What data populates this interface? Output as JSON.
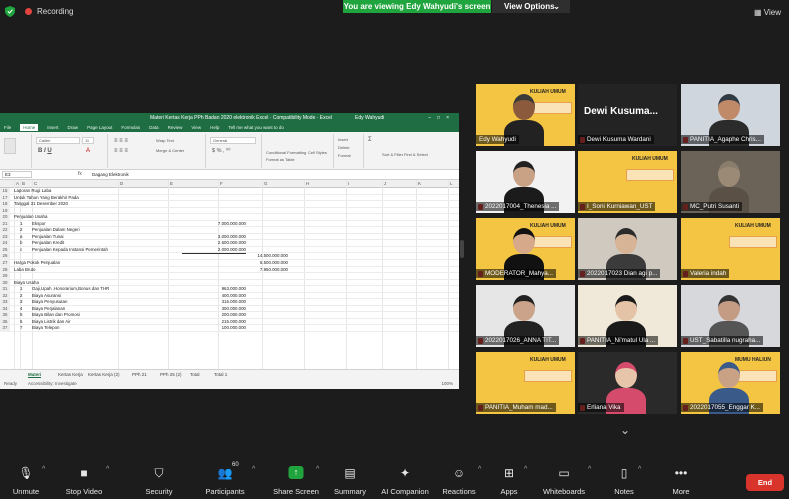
{
  "topbar": {
    "recording": "Recording",
    "viewing": "You are viewing Edy Wahyudi's screen",
    "view_options": "View Options",
    "view_options_caret": "⌄",
    "view": "View"
  },
  "excel": {
    "title": "Materi Kertas Kerja PPh Badan 2020 elektronik Excel · Compatibility Mode · Excel",
    "user": "Edy Wahyudi",
    "tabs": [
      "File",
      "Home",
      "Insert",
      "Draw",
      "Page Layout",
      "Formulas",
      "Data",
      "Review",
      "View",
      "Help",
      "Tell me what you want to do"
    ],
    "active_tab": "Home",
    "font_name": "Calibri",
    "font_size": "11",
    "wrap_text": "Wrap Text",
    "merge_center": "Merge & Center",
    "number_format": "General",
    "conditional_formatting": "Conditional Formatting",
    "format_as_table": "Format as Table",
    "cell_styles": "Cell Styles",
    "insert": "Insert",
    "delete": "Delete",
    "format": "Format",
    "sort_filter": "Sort & Filter",
    "find_select": "Find & Select",
    "name_box": "E3",
    "fx": "fx",
    "formula": "Dagang Elektronik",
    "columns": [
      "A",
      "B",
      "C",
      "D",
      "E",
      "F",
      "G",
      "H",
      "I",
      "J",
      "K",
      "L"
    ],
    "rows": [
      {
        "n": "15",
        "b": "Laporan Rugi Laba",
        "v": "",
        "w": ""
      },
      {
        "n": "17",
        "b": "Untuk Tahun Yang Berakhir Pada",
        "v": "",
        "w": ""
      },
      {
        "n": "18",
        "b": "Tanggal 31 Desember 2020",
        "v": "",
        "w": ""
      },
      {
        "n": "19",
        "b": "",
        "v": "",
        "w": ""
      },
      {
        "n": "20",
        "b": "Penjualan Usaha",
        "v": "",
        "w": ""
      },
      {
        "n": "21",
        "c": "1",
        "d": "Ekspor",
        "v": "7.000.000.000",
        "w": ""
      },
      {
        "n": "22",
        "c": "2",
        "d": "Penjualan Dalam Negeri",
        "v": "",
        "w": ""
      },
      {
        "n": "23",
        "c": "a",
        "d": "Penjualan Tunai",
        "v": "3.000.000.000",
        "w": ""
      },
      {
        "n": "24",
        "c": "b",
        "d": "Penjualan Kredit",
        "v": "2.500.000.000",
        "w": ""
      },
      {
        "n": "25",
        "c": "c",
        "d": "Penjualan Kepada Instansi Pemerintah",
        "v": "2.000.000.000",
        "w": "",
        "hl": true
      },
      {
        "n": "26",
        "b": "",
        "v": "",
        "w": "14.500.000.000"
      },
      {
        "n": "27",
        "b": "Harga Pokok Penjualan",
        "v": "",
        "w": "6.500.000.000"
      },
      {
        "n": "28",
        "b": "Laba Bruto",
        "v": "",
        "w": "7.950.000.000"
      },
      {
        "n": "29",
        "b": "",
        "v": "",
        "w": ""
      },
      {
        "n": "30",
        "b": "Biaya Usaha",
        "v": "",
        "w": ""
      },
      {
        "n": "31",
        "c": "1",
        "d": "Gaji,Upah ,Honorarium,Bonus dan THR",
        "v": "963.000.000",
        "w": ""
      },
      {
        "n": "32",
        "c": "2",
        "d": "Biaya Asuransi",
        "v": "400.000.000",
        "w": ""
      },
      {
        "n": "33",
        "c": "3",
        "d": "Biaya Penyusutan",
        "v": "315.000.000",
        "w": ""
      },
      {
        "n": "34",
        "c": "4",
        "d": "Biaya Perjalanan",
        "v": "300.000.000",
        "w": ""
      },
      {
        "n": "35",
        "c": "5",
        "d": "Biaya Bilan dan Promosi",
        "v": "200.000.000",
        "w": ""
      },
      {
        "n": "36",
        "c": "6",
        "d": "Biaya Listrik dan Air",
        "v": "215.000.000",
        "w": ""
      },
      {
        "n": "37",
        "c": "7",
        "d": "Biaya Telepon",
        "v": "100.000.000",
        "w": ""
      }
    ],
    "sheets": [
      "Materi",
      "Kertas Kerja",
      "Kertas Kerja (2)",
      "PPh 21",
      "PPh 25 (2)",
      "Total",
      "Total 1"
    ],
    "active_sheet": "Materi",
    "status_ready": "Ready",
    "status_access": "Accessibility: Investigate",
    "zoom": "100%"
  },
  "participants": [
    {
      "id": "edy",
      "name": "Edy Wahyudi",
      "active": true
    },
    {
      "id": "dewi",
      "name": "Dewi Kusuma Wardani",
      "big_name": "Dewi  Kusuma..."
    },
    {
      "id": "agape",
      "name": "PANITIA_Agaphe Chris..."
    },
    {
      "id": "thenesia",
      "name": "2022017004_Thenesia ..."
    },
    {
      "id": "soni",
      "name": "I_Soni Kurniawan_UST"
    },
    {
      "id": "mc",
      "name": "MC_Putri Susanti"
    },
    {
      "id": "moderator",
      "name": "MODERATOR_Mahya..."
    },
    {
      "id": "dian",
      "name": "2022017023 Dian agi p..."
    },
    {
      "id": "valeria",
      "name": "Valeria indah"
    },
    {
      "id": "anna",
      "name": "2022017026_ANNA TIT..."
    },
    {
      "id": "nimatul",
      "name": "PANITIA_Ni'matul Ula ..."
    },
    {
      "id": "sabatilla",
      "name": "UST_Sabatilla nugraha..."
    },
    {
      "id": "muhammad",
      "name": "PANITIA_Muham mad..."
    },
    {
      "id": "erliana",
      "name": "Erliana Vika"
    },
    {
      "id": "enggar",
      "name": "2022017055_Enggar K..."
    }
  ],
  "poster": {
    "line1": "KULIAH UMUM",
    "line2": "PRAKTIK PERPAJAKAN 2",
    "line3": "MUMU HALIUN"
  },
  "toolbar": {
    "unmute": "Unmute",
    "stop_video": "Stop Video",
    "security": "Security",
    "participants": "Participants",
    "participants_count": "60",
    "share_screen": "Share Screen",
    "summary": "Summary",
    "ai_companion": "AI Companion",
    "reactions": "Reactions",
    "apps": "Apps",
    "whiteboards": "Whiteboards",
    "notes": "Notes",
    "more": "More",
    "end": "End"
  },
  "colors": {
    "accent_green": "#20a53e",
    "end_red": "#d9342b",
    "excel_green": "#1f6e43",
    "poster_yellow": "#f4c542"
  }
}
